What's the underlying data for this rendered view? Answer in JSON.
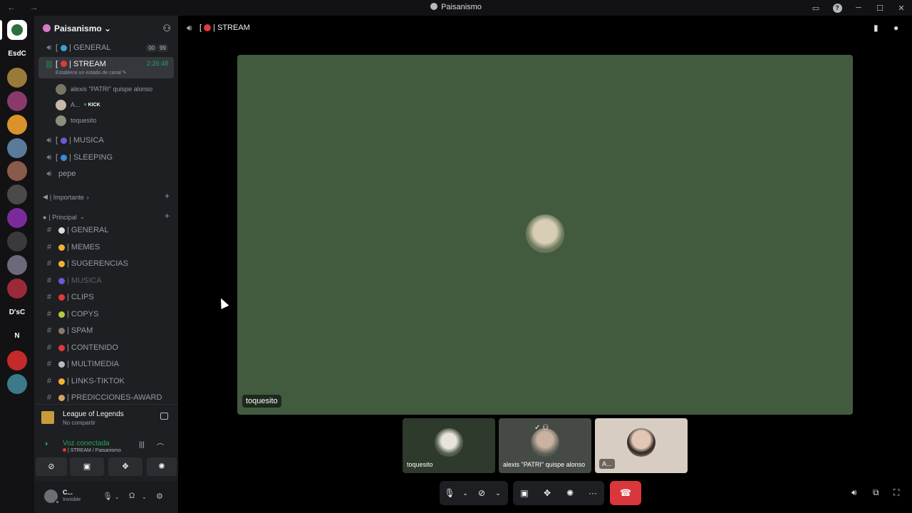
{
  "window": {
    "title": "Paisanismo",
    "nav_arrows": "← →",
    "controls": [
      "─",
      "☐",
      "✕"
    ]
  },
  "rail": {
    "servers": [
      {
        "label": "",
        "color": "#2d6e3e"
      },
      {
        "label": "EsdC",
        "color": ""
      },
      {
        "label": "",
        "color": "#9a7a3a"
      },
      {
        "label": "",
        "color": "#8a3a6a"
      },
      {
        "label": "",
        "color": "#d9932a"
      },
      {
        "label": "",
        "color": "#5a7a9a"
      },
      {
        "label": "",
        "color": "#8a5a4a"
      },
      {
        "label": "",
        "color": "#4a4a4a"
      },
      {
        "label": "",
        "color": "#7a2a9a"
      },
      {
        "label": "",
        "color": "#3a3a3a"
      },
      {
        "label": "",
        "color": "#6a6a7a"
      },
      {
        "label": "",
        "color": "#9a2a3a"
      },
      {
        "label": "D'sC",
        "color": ""
      },
      {
        "label": "N",
        "color": ""
      },
      {
        "label": "",
        "color": "#c42a2a"
      },
      {
        "label": "",
        "color": "#3a7a8a"
      }
    ]
  },
  "guild": {
    "name": "Paisanismo"
  },
  "voice_channels": [
    {
      "name": "| GENERAL",
      "prefix": "[",
      "emoji_color": "#3aa0d8",
      "counts": [
        "00",
        "99"
      ]
    },
    {
      "name": "| STREAM",
      "prefix": "[",
      "emoji_color": "#e03a3a",
      "time": "2:26:48",
      "subtitle": "Establece un estado de canal ✎"
    },
    {
      "name": "| MUSICA",
      "prefix": "[",
      "emoji_color": "#6a5ad8"
    },
    {
      "name": "| SLEEPING",
      "prefix": "[",
      "emoji_color": "#3a8ad8"
    },
    {
      "name": "pepe",
      "prefix": "",
      "emoji_color": ""
    }
  ],
  "voice_users": [
    {
      "name": "alexis \"PATRI\" quispe alonso"
    },
    {
      "name": "A...",
      "badge": "KICK"
    },
    {
      "name": "toquesito"
    }
  ],
  "categories": [
    {
      "name": "| Importante",
      "chevron": "›"
    },
    {
      "name": "| Principal",
      "chevron": "⌄"
    }
  ],
  "text_channels": [
    {
      "name": "| GENERAL",
      "emoji_color": "#dbdee1"
    },
    {
      "name": "| MEMES",
      "emoji_color": "#f0b232"
    },
    {
      "name": "| SUGERENCIAS",
      "emoji_color": "#f0b232"
    },
    {
      "name": "| MUSICA",
      "emoji_color": "#6a5ad8",
      "dim": true
    },
    {
      "name": "| CLIPS",
      "emoji_color": "#e03a3a"
    },
    {
      "name": "| COPYS",
      "emoji_color": "#b8c83a"
    },
    {
      "name": "| SPAM",
      "emoji_color": "#8a7a6a"
    },
    {
      "name": "| CONTENIDO",
      "emoji_color": "#e03a3a"
    },
    {
      "name": "| MULTIMEDIA",
      "emoji_color": "#b5bac1"
    },
    {
      "name": "| LINKS-TIKTOK",
      "emoji_color": "#f0b232"
    },
    {
      "name": "| PREDICCIONES-AWARD",
      "emoji_color": "#d8a36a"
    }
  ],
  "activity": {
    "title": "League of Legends",
    "subtitle": "No compartir"
  },
  "voice_panel": {
    "status": "Voz conectada",
    "channel": "| STREAM / Paisanismo",
    "buttons": [
      "camera-off",
      "screen-share",
      "activities",
      "soundboard"
    ]
  },
  "user_panel": {
    "name": "C...",
    "status": "Invisible"
  },
  "call": {
    "channel_prefix": "[",
    "channel_name": "| STREAM",
    "stage_user": "toquesito",
    "stage_bg": "#425b3f",
    "tiles": [
      {
        "name": "toquesito",
        "bg": "#2e3a2c"
      },
      {
        "name": "alexis \"PATRI\" quispe alonso",
        "bg": "#454a44"
      },
      {
        "name": "A...",
        "bg": "#d8cdc3"
      }
    ]
  },
  "colors": {
    "accent_green": "#23a55a",
    "hangup_red": "#da373c",
    "sidebar_bg": "#1e1f22",
    "rail_bg": "#121214"
  }
}
